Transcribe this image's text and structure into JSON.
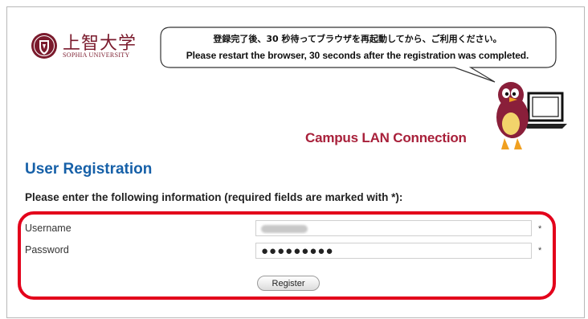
{
  "logo": {
    "name_jp": "上智大学",
    "name_en": "SOPHIA UNIVERSITY"
  },
  "bubble": {
    "message_jp": "登録完了後、30 秒待ってブラウザを再起動してから、ご利用ください。",
    "message_en": "Please restart the browser, 30 seconds after the registration was completed."
  },
  "banner": {
    "title": "Campus LAN Connection",
    "mascot_icon": "bird-mascot-with-laptop"
  },
  "form": {
    "title": "User Registration",
    "instructions": "Please enter the following information (required fields are marked with *):",
    "username_label": "Username",
    "password_label": "Password",
    "password_value": "●●●●●●●●●",
    "required_mark": "*",
    "register_label": "Register"
  },
  "colors": {
    "brand": "#7a1a2c",
    "title_blue": "#1660a8",
    "highlight_red": "#e3001b",
    "banner_red": "#a8203a"
  }
}
